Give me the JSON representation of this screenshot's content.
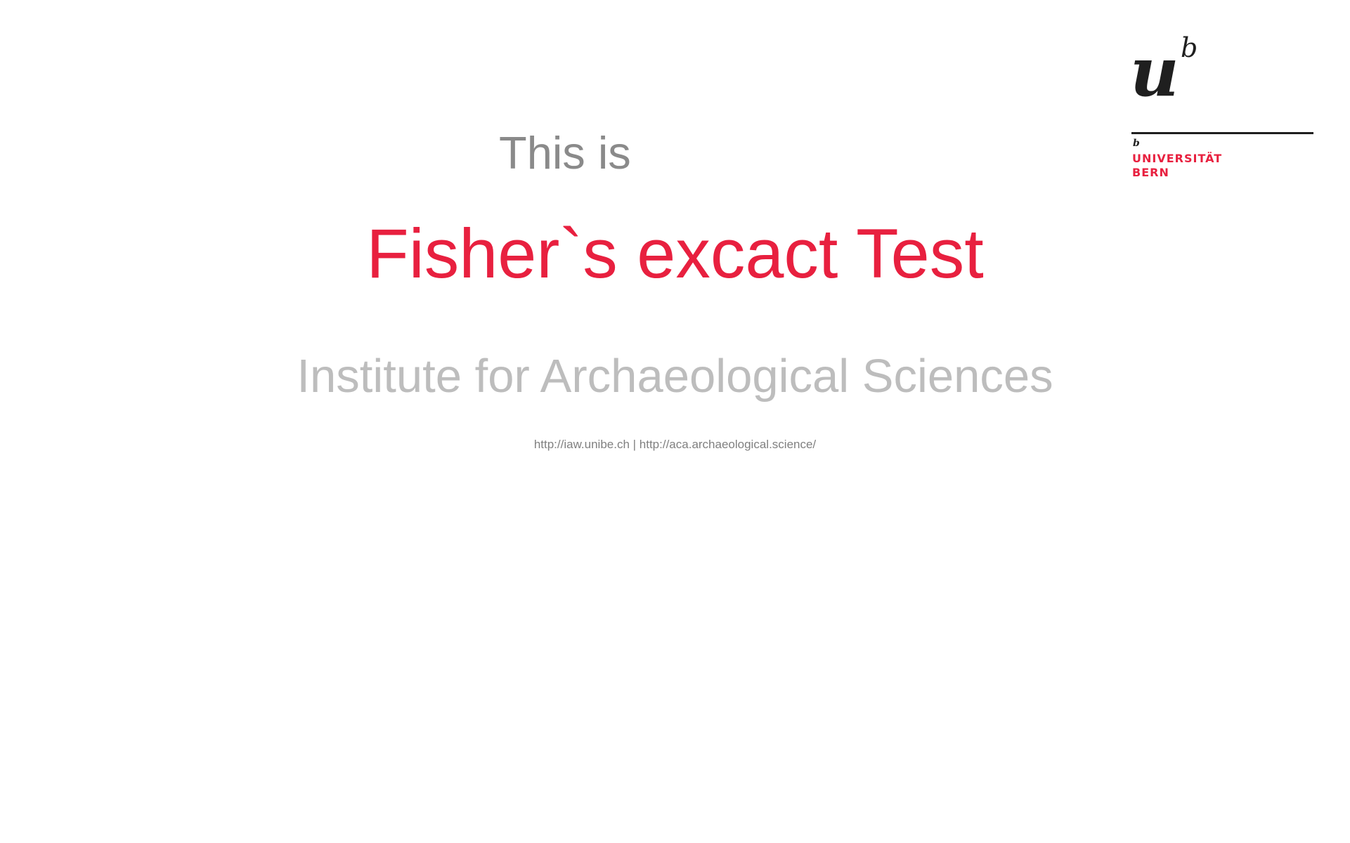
{
  "slide": {
    "pre_title": "This is",
    "title": "Fisher`s excact Test",
    "institute": "Institute for Archaeological Sciences",
    "links": "http://iaw.unibe.ch | http://aca.archaeological.science/"
  },
  "logo": {
    "mark_letter": "u",
    "mark_superscript": "b",
    "small_mark": "b",
    "line1": "UNIVERSITÄT",
    "line2": "BERN"
  },
  "colors": {
    "accent": "#e8203f",
    "pre_title": "#8a8a8a",
    "institute": "#bdbdbd",
    "links": "#808080",
    "logo_dark": "#1f1f1f"
  }
}
